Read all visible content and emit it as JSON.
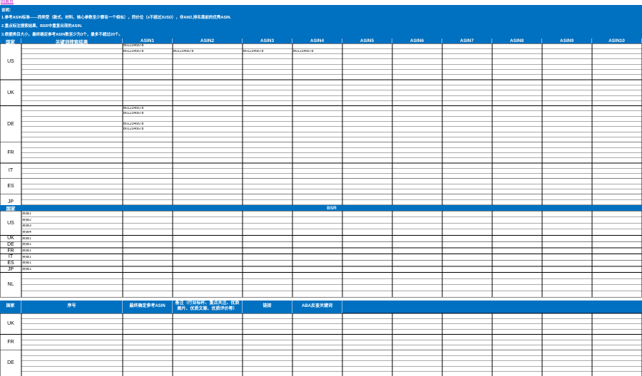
{
  "back_link": "回首页",
  "notes": {
    "title": "说明：",
    "lines": [
      "1.参考ASIN标准——同类型（款式、材料、核心参数至少要有一个相似），同价位（±不超过3USD），非AMZ,排名靠前的优秀ASIN.",
      "2.重点标注搜索结果、BSR中重复出现的ASIN.",
      "3.根据类目大小，最终确定参考ASIN数至少为3个，最多不超过20个。"
    ]
  },
  "section1": {
    "headers": [
      "国家",
      "关键词搜索结果",
      "ASIN1",
      "ASIN2",
      "ASIN3",
      "ASIN4",
      "ASIN5",
      "ASIN6",
      "ASIN7",
      "ASIN8",
      "ASIN9",
      "ASIN10"
    ],
    "countries": [
      "US",
      "UK",
      "DE",
      "FR",
      "IT",
      "ES",
      "JP"
    ],
    "asin_values": [
      {
        "row": 0,
        "col": 2,
        "text": "B012345678"
      },
      {
        "row": 1,
        "col": 2,
        "text": "B012345678"
      },
      {
        "row": 1,
        "col": 3,
        "text": "B012345678"
      },
      {
        "row": 1,
        "col": 4,
        "text": "B012345678"
      },
      {
        "row": 1,
        "col": 5,
        "text": "B012345678"
      },
      {
        "row": 12,
        "col": 2,
        "text": "B012345678"
      },
      {
        "row": 13,
        "col": 2,
        "text": "B012345678"
      },
      {
        "row": 15,
        "col": 2,
        "text": "B012345678"
      },
      {
        "row": 16,
        "col": 2,
        "text": "B012345678"
      }
    ]
  },
  "section2": {
    "headers": [
      "国家",
      "BSR"
    ],
    "countries": [
      "US",
      "UK",
      "DE",
      "FR",
      "IT",
      "ES",
      "JP",
      "NL"
    ],
    "categories": [
      {
        "row": 0,
        "text": "类目1"
      },
      {
        "row": 1,
        "text": "类目2"
      },
      {
        "row": 2,
        "text": "类目3"
      },
      {
        "row": 3,
        "text": "类目4"
      },
      {
        "row": 4,
        "text": "类目1"
      },
      {
        "row": 5,
        "text": "类目1"
      },
      {
        "row": 6,
        "text": "类目1"
      },
      {
        "row": 7,
        "text": "类目1"
      },
      {
        "row": 8,
        "text": "类目1"
      },
      {
        "row": 9,
        "text": "类目1"
      }
    ]
  },
  "section3": {
    "headers": [
      "国家",
      "序号",
      "最终确定参考ASIN",
      "备注（行业标杆、重点关注、优质图片、优质文案、优质评价等）",
      "链接",
      "ABA反查关键词"
    ],
    "countries": [
      "UK",
      "FR",
      "DE"
    ]
  },
  "colors": {
    "header_bg": "#0070c0",
    "header_text": "#ffffff",
    "grid": "#000000",
    "link": "#c000c0"
  }
}
